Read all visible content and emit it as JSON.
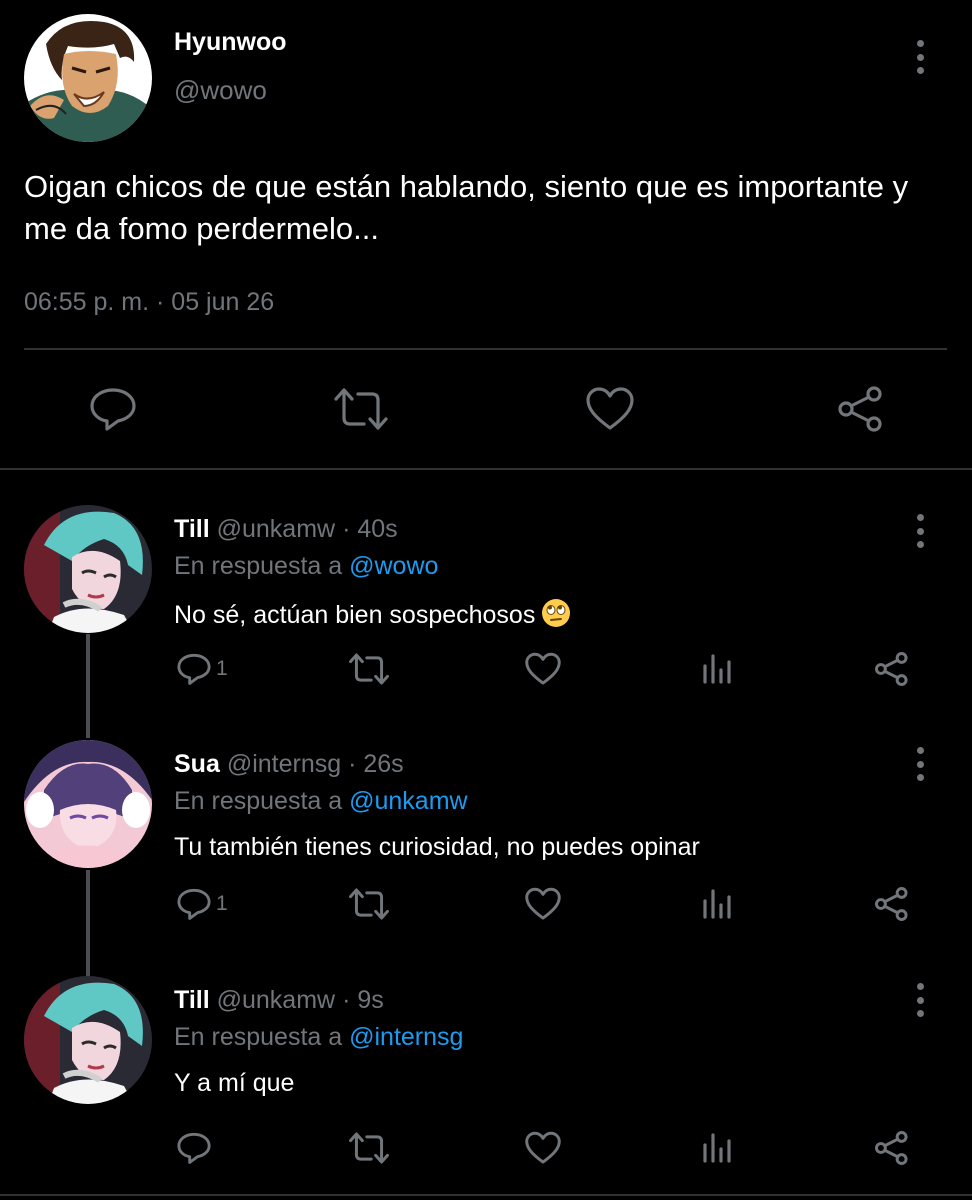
{
  "main": {
    "author": "Hyunwoo",
    "handle": "@wowo",
    "text": "Oigan chicos de que están hablando, siento que es importante y me da fomo perdermelo...",
    "timestamp": "06:55 p. m. · 05 jun 26",
    "actions": [
      "reply-icon",
      "retweet-icon",
      "heart-icon",
      "share-icon"
    ]
  },
  "replies": [
    {
      "author": "Till",
      "handle": "@unkamw",
      "time": "· 40s",
      "reply_prefix": "En respuesta a",
      "reply_to": "@wowo",
      "text": "No sé, actúan bien sospechosos",
      "emoji": "eye-roll-emoji",
      "reply_count": "1"
    },
    {
      "author": "Sua",
      "handle": "@internsg",
      "time": "· 26s",
      "reply_prefix": "En respuesta a",
      "reply_to": "@unkamw",
      "text": "Tu también tienes curiosidad, no puedes opinar",
      "reply_count": "1"
    },
    {
      "author": "Till",
      "handle": "@unkamw",
      "time": "· 9s",
      "reply_prefix": "En respuesta a",
      "reply_to": "@internsg",
      "text": "Y a mí que",
      "reply_count": ""
    }
  ],
  "colors": {
    "background": "#000000",
    "text": "#ffffff",
    "muted": "#71767b",
    "mention": "#1d9bf0",
    "divider": "#2f3336"
  }
}
